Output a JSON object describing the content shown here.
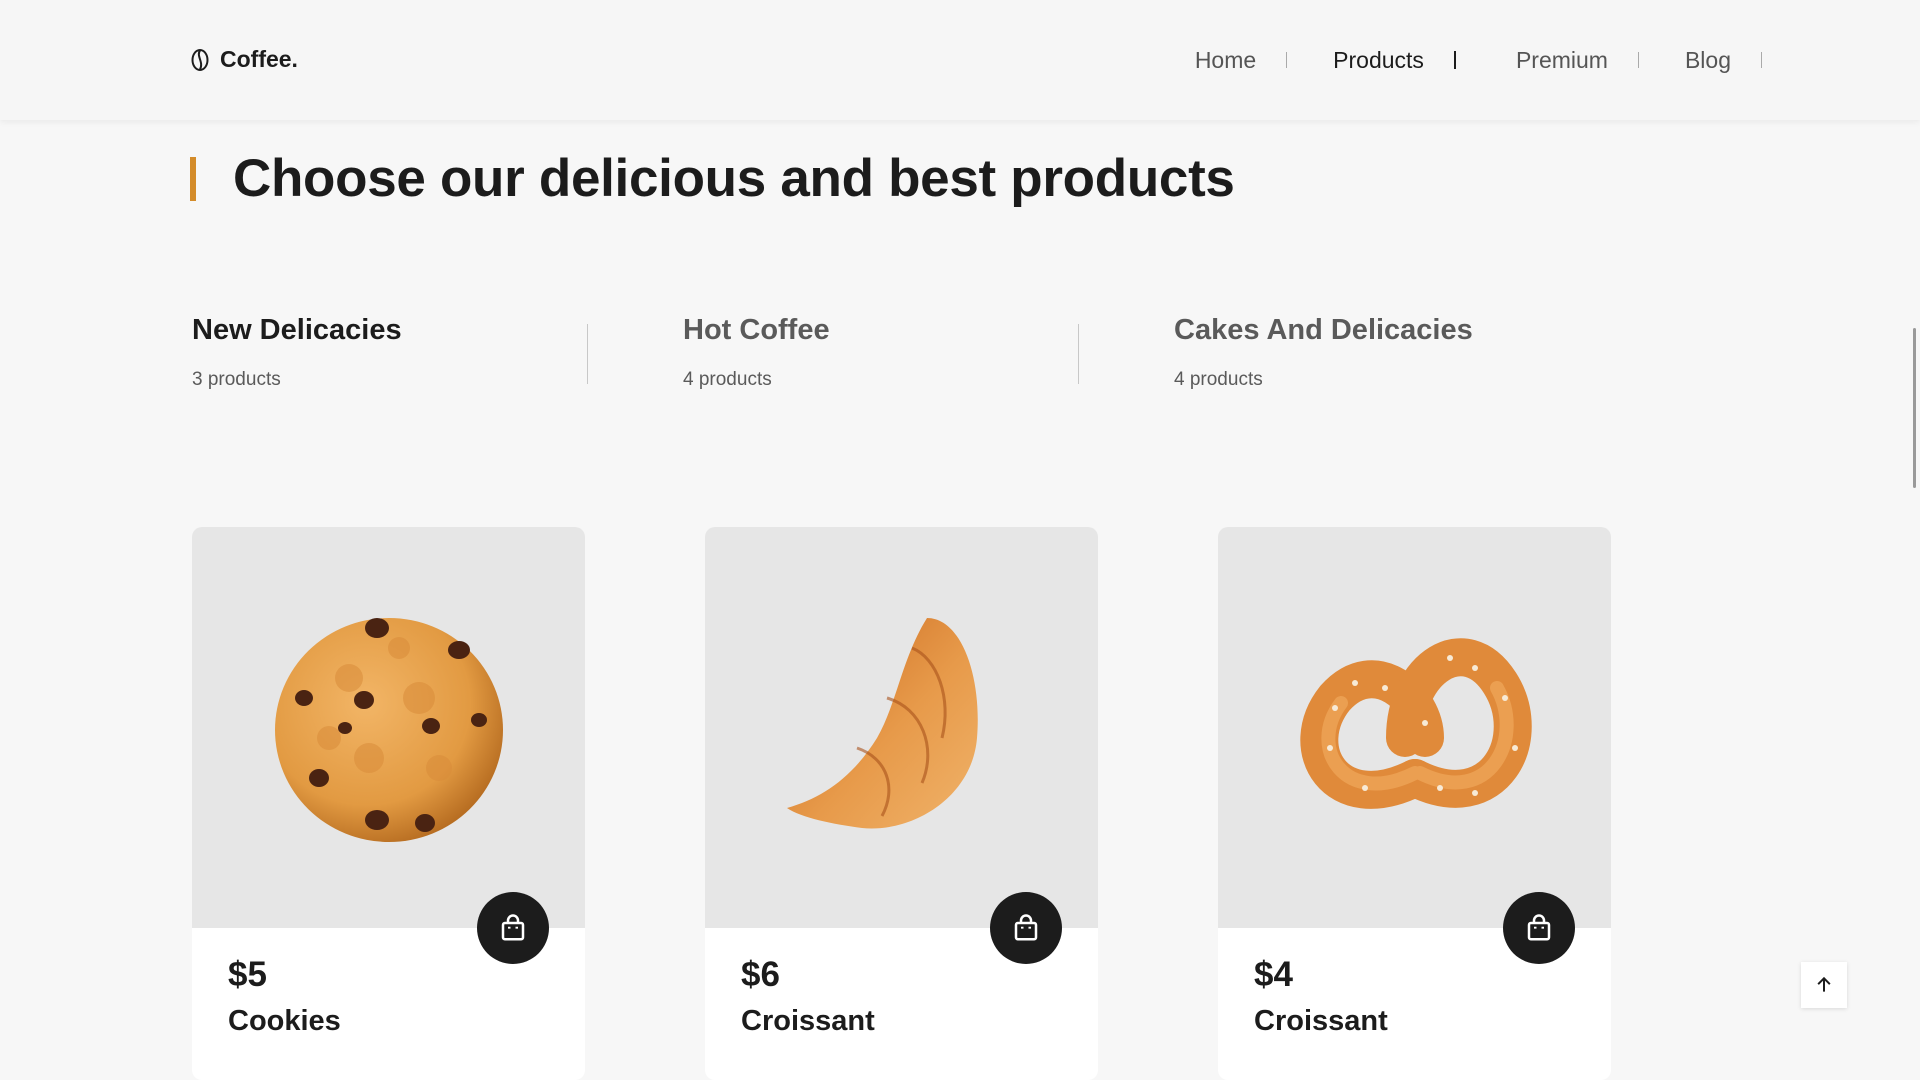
{
  "header": {
    "logo_text": "Coffee.",
    "logo_icon": "coffee-bean-icon",
    "nav": [
      {
        "label": "Home",
        "active": false
      },
      {
        "label": "Products",
        "active": true
      },
      {
        "label": "Premium",
        "active": false
      },
      {
        "label": "Blog",
        "active": false
      }
    ]
  },
  "section": {
    "title": "Choose our delicious and best products",
    "accent_color": "#d48c2a"
  },
  "categories": [
    {
      "name": "New Delicacies",
      "count": "3 products",
      "active": true
    },
    {
      "name": "Hot Coffee",
      "count": "4 products",
      "active": false
    },
    {
      "name": "Cakes And Delicacies",
      "count": "4 products",
      "active": false
    }
  ],
  "products": [
    {
      "price": "$5",
      "name": "Cookies",
      "image": "cookie-image"
    },
    {
      "price": "$6",
      "name": "Croissant",
      "image": "croissant-image"
    },
    {
      "price": "$4",
      "name": "Croissant",
      "image": "pretzel-image"
    }
  ],
  "icons": {
    "cart": "shopping-bag-icon",
    "back_to_top": "arrow-up-icon"
  },
  "colors": {
    "dark": "#1c1c1c",
    "background": "#f7f7f7",
    "card_image_bg": "#e6e6e6"
  }
}
